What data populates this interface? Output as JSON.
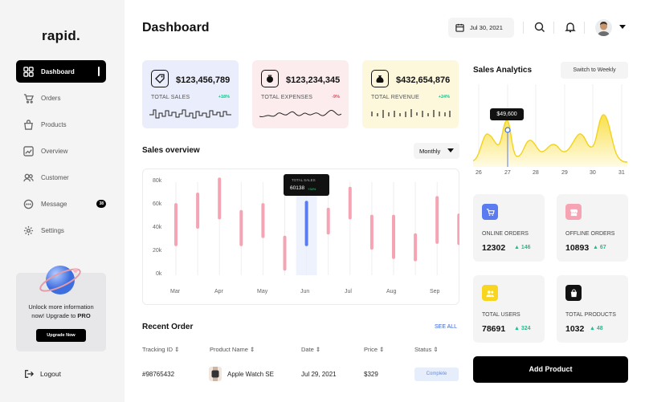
{
  "brand": "rapid.",
  "sidebar": {
    "items": [
      {
        "label": "Dashboard"
      },
      {
        "label": "Orders"
      },
      {
        "label": "Products"
      },
      {
        "label": "Overview"
      },
      {
        "label": "Customer"
      },
      {
        "label": "Message",
        "badge": "38"
      },
      {
        "label": "Settings"
      }
    ],
    "upgrade": {
      "line1": "Unlock more information",
      "line2": "now! Upgrade to ",
      "pro": "PRO",
      "button": "Upgrade Now"
    },
    "logout": "Logout"
  },
  "header": {
    "title": "Dashboard",
    "date": "Jul 30, 2021"
  },
  "cards": [
    {
      "amount": "$123,456,789",
      "label": "TOTAL SALES",
      "change": "+18%",
      "color": "#eaedfb",
      "change_color": "#1bbf8c"
    },
    {
      "amount": "$123,234,345",
      "label": "TOTAL EXPENSES",
      "change": "-9%",
      "color": "#fcecee",
      "change_color": "#e04b5a"
    },
    {
      "amount": "$432,654,876",
      "label": "TOTAL REVENUE",
      "change": "+24%",
      "color": "#fdf8dc",
      "change_color": "#1bbf8c"
    }
  ],
  "sales_overview": {
    "title": "Sales overview",
    "filter": "Monthly",
    "tooltip": {
      "label": "TOTAL SALES",
      "value": "60138",
      "change": "+34%"
    },
    "y_ticks": [
      "80k",
      "60k",
      "40k",
      "20k",
      "0k"
    ],
    "x_labels": [
      "Mar",
      "Apr",
      "May",
      "Jun",
      "Jul",
      "Aug",
      "Sep"
    ]
  },
  "recent_order": {
    "title": "Recent Order",
    "see_all": "SEE ALL",
    "headers": [
      "Tracking ID",
      "Product Name",
      "Date",
      "Price",
      "Status"
    ],
    "rows": [
      {
        "id": "#98765432",
        "product": "Apple Watch SE",
        "date": "Jul 29, 2021",
        "price": "$329",
        "status": "Complete"
      }
    ]
  },
  "analytics": {
    "title": "Sales Analytics",
    "switch_label": "Switch to Weekly",
    "tooltip": "$49,600",
    "days": [
      "26",
      "27",
      "28",
      "29",
      "30",
      "31"
    ]
  },
  "stats": [
    {
      "label": "ONLINE ORDERS",
      "value": "12302",
      "change": "146",
      "icon_color": "#5b7cf0"
    },
    {
      "label": "OFFLINE ORDERS",
      "value": "10893",
      "change": "67",
      "icon_color": "#f6a4b4"
    },
    {
      "label": "TOTAL USERS",
      "value": "78691",
      "change": "324",
      "icon_color": "#f8d51e"
    },
    {
      "label": "TOTAL PRODUCTS",
      "value": "1032",
      "change": "48",
      "icon_color": "#111111"
    }
  ],
  "add_product": "Add Product",
  "chart_data": [
    {
      "type": "bar",
      "title": "Sales overview",
      "categories": [
        "Mar",
        "Apr",
        "May",
        "Jun",
        "Jul",
        "Aug",
        "Sep"
      ],
      "ylim": [
        0,
        80000
      ],
      "series": [
        {
          "values": [
            [
              25000,
              62000
            ],
            [
              40000,
              71000
            ],
            [
              48000,
              84000
            ],
            [
              25000,
              56000
            ],
            [
              32000,
              62000
            ],
            [
              4000,
              34000
            ],
            [
              25000,
              64000
            ],
            [
              35000,
              58000
            ],
            [
              48000,
              76000
            ],
            [
              22000,
              52000
            ],
            [
              14000,
              52000
            ],
            [
              12000,
              36000
            ],
            [
              27000,
              68000
            ],
            [
              26000,
              53000
            ]
          ]
        }
      ],
      "highlight": {
        "category": "Jun",
        "value": 60138
      }
    },
    {
      "type": "area",
      "title": "Sales Analytics",
      "x": [
        "26",
        "27",
        "28",
        "29",
        "30",
        "31"
      ],
      "highlight": {
        "x": "27",
        "value": "$49,600"
      }
    }
  ]
}
